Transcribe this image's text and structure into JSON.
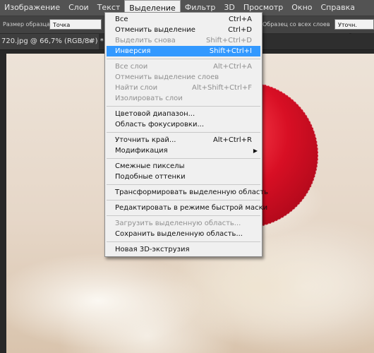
{
  "menubar": {
    "items": [
      "Изображение",
      "Слои",
      "Текст",
      "Выделение",
      "Фильтр",
      "3D",
      "Просмотр",
      "Окно",
      "Справка"
    ]
  },
  "options": {
    "sample_size_label": "Размер образца:",
    "sample_size_value": "Точка",
    "sample_all_layers": "Образец со всех слоев",
    "refine_edge_button": "Уточн. край..."
  },
  "document": {
    "tab_title": "720.jpg @ 66,7% (RGB/8#) *",
    "close_glyph": "×"
  },
  "select_menu": {
    "items": [
      {
        "label": "Все",
        "shortcut": "Ctrl+A",
        "disabled": false
      },
      {
        "label": "Отменить выделение",
        "shortcut": "Ctrl+D",
        "disabled": false
      },
      {
        "label": "Выделить снова",
        "shortcut": "Shift+Ctrl+D",
        "disabled": true
      },
      {
        "label": "Инверсия",
        "shortcut": "Shift+Ctrl+I",
        "disabled": false,
        "highlighted": true
      },
      {
        "separator": true
      },
      {
        "label": "Все слои",
        "shortcut": "Alt+Ctrl+A",
        "disabled": true
      },
      {
        "label": "Отменить выделение слоев",
        "shortcut": "",
        "disabled": true
      },
      {
        "label": "Найти слои",
        "shortcut": "Alt+Shift+Ctrl+F",
        "disabled": true
      },
      {
        "label": "Изолировать слои",
        "shortcut": "",
        "disabled": true
      },
      {
        "separator": true
      },
      {
        "label": "Цветовой диапазон...",
        "shortcut": "",
        "disabled": false
      },
      {
        "label": "Область фокусировки...",
        "shortcut": "",
        "disabled": false
      },
      {
        "separator": true
      },
      {
        "label": "Уточнить край...",
        "shortcut": "Alt+Ctrl+R",
        "disabled": false
      },
      {
        "label": "Модификация",
        "shortcut": "",
        "disabled": false,
        "submenu": true
      },
      {
        "separator": true
      },
      {
        "label": "Смежные пикселы",
        "shortcut": "",
        "disabled": false
      },
      {
        "label": "Подобные оттенки",
        "shortcut": "",
        "disabled": false
      },
      {
        "separator": true
      },
      {
        "label": "Трансформировать выделенную область",
        "shortcut": "",
        "disabled": false
      },
      {
        "separator": true
      },
      {
        "label": "Редактировать в режиме быстрой маски",
        "shortcut": "",
        "disabled": false
      },
      {
        "separator": true
      },
      {
        "label": "Загрузить выделенную область...",
        "shortcut": "",
        "disabled": true
      },
      {
        "label": "Сохранить выделенную область...",
        "shortcut": "",
        "disabled": false
      },
      {
        "separator": true
      },
      {
        "label": "Новая 3D-экструзия",
        "shortcut": "",
        "disabled": false
      }
    ]
  },
  "colors": {
    "menu_highlight": "#3399ff",
    "menubar_bg": "#535353",
    "workspace_bg": "#282828"
  }
}
